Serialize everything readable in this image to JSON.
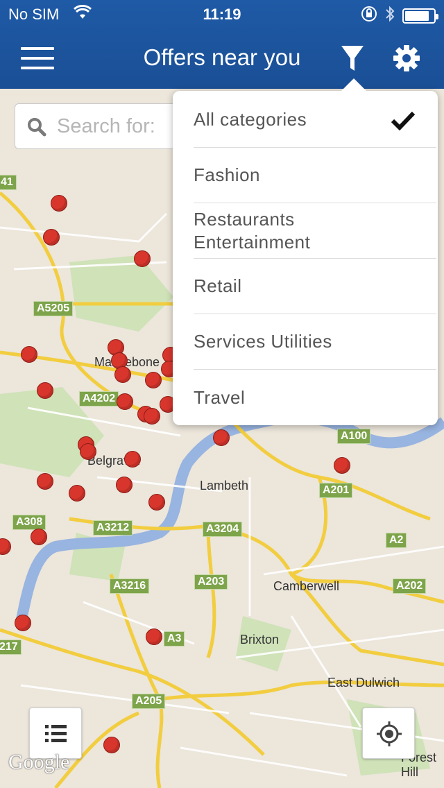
{
  "status": {
    "carrier": "No SIM",
    "time": "11:19",
    "battery_percent": 80
  },
  "nav": {
    "title": "Offers near you",
    "menu_icon": "hamburger-icon",
    "filter_icon": "filter-icon",
    "settings_icon": "gear-icon"
  },
  "search": {
    "placeholder": "Search for:"
  },
  "filter_menu": {
    "selected": "All categories",
    "items": [
      {
        "label": "All categories",
        "checked": true
      },
      {
        "label": "Fashion"
      },
      {
        "label": "Restaurants\nEntertainment"
      },
      {
        "label": "Retail"
      },
      {
        "label": "Services Utilities"
      },
      {
        "label": "Travel"
      }
    ]
  },
  "map": {
    "places": [
      "Marylebone",
      "Belgravia",
      "Lambeth",
      "Camberwell",
      "Brixton",
      "East Dulwich",
      "Forest Hill"
    ],
    "roads": [
      "41",
      "A5205",
      "A4202",
      "A100",
      "A201",
      "A308",
      "A3212",
      "A3204",
      "A2",
      "A203",
      "A202",
      "A3216",
      "A3",
      "217",
      "A205"
    ],
    "attribution": "Google"
  },
  "controls": {
    "list_icon": "list-icon",
    "locate_icon": "locate-icon"
  }
}
